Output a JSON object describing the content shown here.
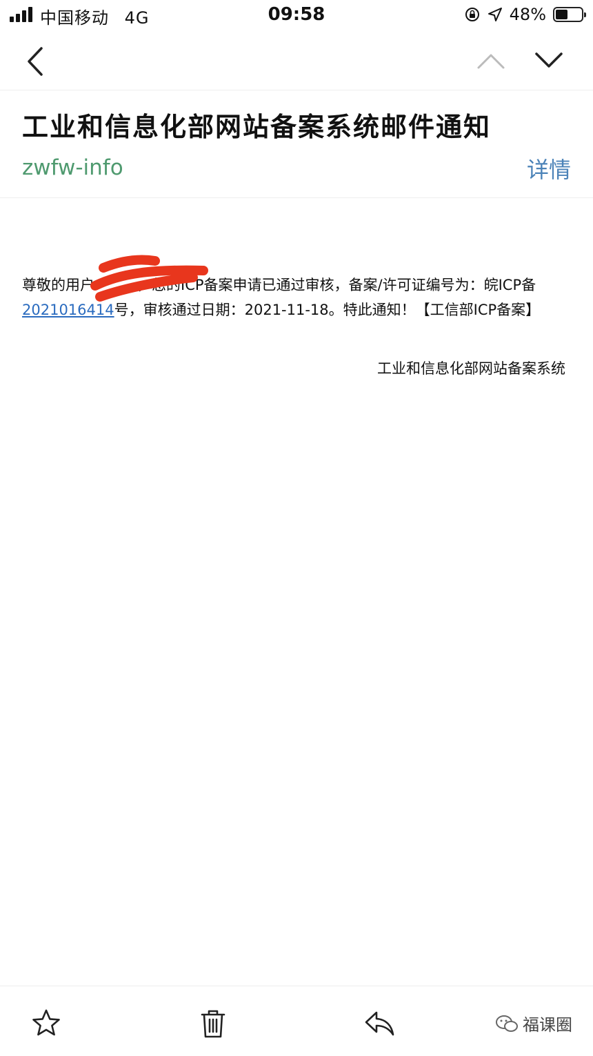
{
  "status_bar": {
    "carrier": "中国移动",
    "network": "4G",
    "time": "09:58",
    "battery": "48%",
    "battery_level": 0.48
  },
  "nav": {
    "back_icon": "chevron-left-icon",
    "prev_icon": "chevron-up-icon",
    "next_icon": "chevron-down-icon"
  },
  "email": {
    "subject": "工业和信息化部网站备案系统邮件通知",
    "sender": "zwfw-info",
    "details_label": "详情",
    "body": {
      "part1": "尊敬的用户",
      "part2": "，您的ICP备案申请已通过审核，备案/许可证编号为：皖ICP备",
      "license_number": "2021016414",
      "part3": "号，审核通过日期：2021-11-18。特此通知！【工信部ICP备案】"
    },
    "signature": "工业和信息化部网站备案系统"
  },
  "toolbar": {
    "star_icon": "star-icon",
    "trash_icon": "trash-icon",
    "reply_icon": "reply-icon"
  },
  "watermark": {
    "text": "福课圈",
    "icon": "wechat-icon"
  },
  "colors": {
    "sender_green": "#4f9a6f",
    "details_blue": "#4c83b8",
    "link_blue": "#2a6bbf",
    "redaction_red": "#e8361d"
  }
}
